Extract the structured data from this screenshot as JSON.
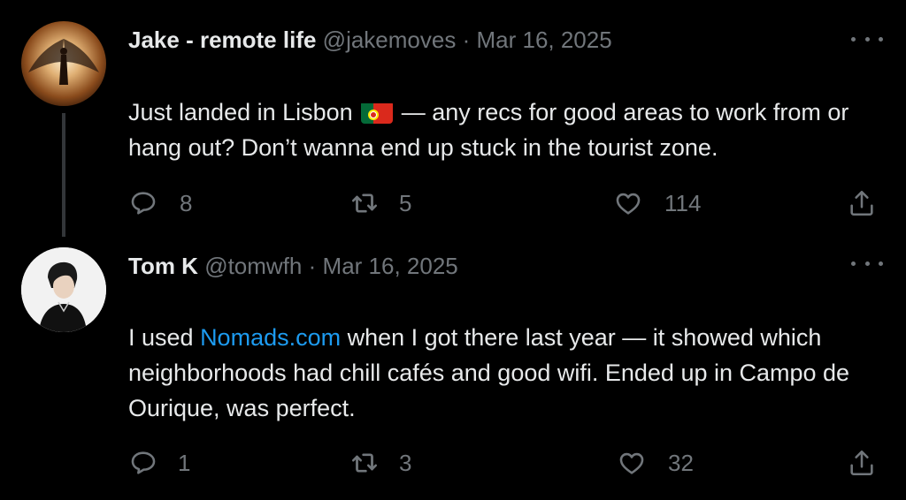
{
  "tweets": [
    {
      "name": "Jake - remote life",
      "handle": "@jakemoves",
      "separator": "·",
      "date": "Mar 16, 2025",
      "text_before_flag": "Just landed in Lisbon",
      "flag_icon": "portugal-flag-icon",
      "text_after_flag": " — any recs for good areas to work from or hang out? Don’t wanna end up stuck in the tourist zone.",
      "replies": "8",
      "retweets": "5",
      "likes": "114"
    },
    {
      "name": "Tom K",
      "handle": "@tomwfh",
      "separator": "·",
      "date": "Mar 16, 2025",
      "text_before_link": "I used ",
      "link": "Nomads.com",
      "text_after_link": " when I got there last year — it showed which neighborhoods had chill cafés and good wifi. Ended up in Campo de Ourique, was perfect.",
      "replies": "1",
      "retweets": "3",
      "likes": "32"
    }
  ],
  "colors": {
    "background": "#000000",
    "text": "#e7e9ea",
    "muted": "#71767b",
    "link": "#1d9bf0",
    "thread_line": "#333639"
  },
  "icons": [
    "more-icon",
    "reply-icon",
    "retweet-icon",
    "like-icon",
    "share-icon"
  ]
}
